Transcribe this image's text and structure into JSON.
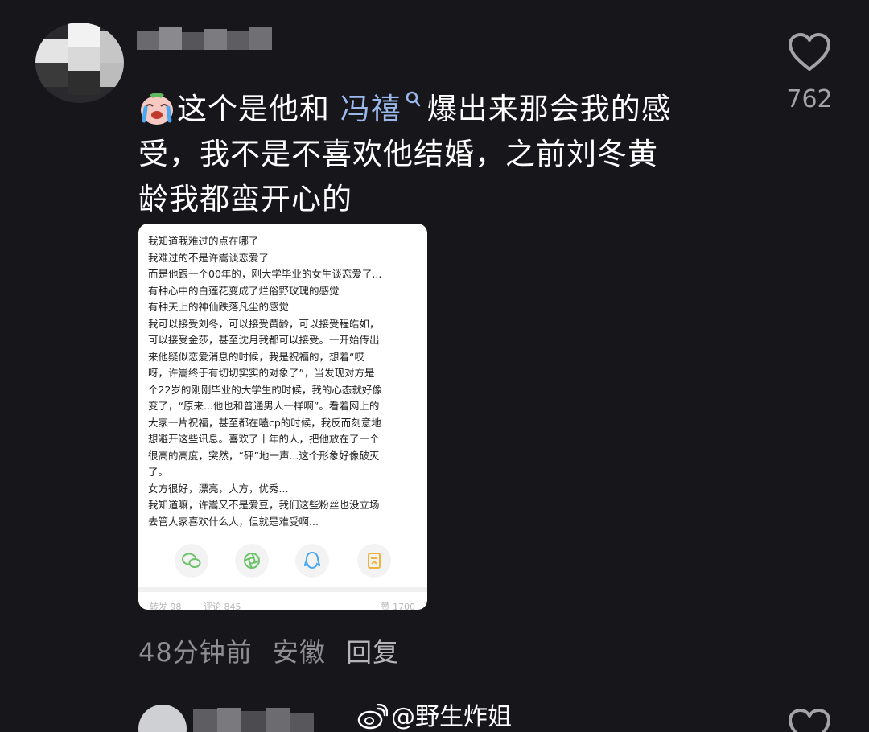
{
  "comment": {
    "text_before_mention": "这个是他和 ",
    "mention": "冯禧",
    "text_line1_rest": "爆出来那会我的感",
    "text_line2": "受，我不是不喜欢他结婚，之前刘冬黄",
    "text_line3": "龄我都蛮开心的",
    "emoji_icon": "crying-face-icon",
    "mention_icon": "search-icon"
  },
  "like": {
    "count": "762",
    "icon": "heart-outline-icon"
  },
  "card": {
    "lines": [
      "我知道我难过的点在哪了",
      "我难过的不是许嵩谈恋爱了",
      "而是他跟一个00年的，刚大学毕业的女生谈恋爱了...",
      "有种心中的白莲花变成了烂俗野玫瑰的感觉",
      "有种天上的神仙跌落凡尘的感觉",
      "我可以接受刘冬，可以接受黄龄，可以接受程皓如，",
      "可以接受金莎，甚至沈月我都可以接受。一开始传出",
      "来他疑似恋爱消息的时候，我是祝福的，想着“哎",
      "呀，许嵩终于有切切实实的对象了”，当发现对方是",
      "个22岁的刚刚毕业的大学生的时候，我的心态就好像",
      "变了，“原来...他也和普通男人一样啊”。看着网上的",
      "大家一片祝福，甚至都在嗑cp的时候，我反而刻意地",
      "想避开这些讯息。喜欢了十年的人，把他放在了一个",
      "很高的高度，突然，“砰”地一声...这个形象好像破灭",
      "了。",
      "女方很好，漂亮，大方，优秀...",
      "我知道嘛，许嵩又不是爱豆，我们这些粉丝也没立场",
      "去管人家喜欢什么人，但就是难受啊..."
    ],
    "share_icons": [
      "wechat-icon",
      "moments-icon",
      "qq-icon",
      "qzone-icon"
    ],
    "footer": {
      "repost": "转发 98",
      "comments": "评论 845",
      "likes": "赞 1700"
    }
  },
  "meta": {
    "time": "48分钟前",
    "location": "安徽",
    "reply": "回复"
  },
  "watermark": {
    "text": "@野生炸姐",
    "icon": "weibo-icon"
  },
  "colors": {
    "background": "#17161b",
    "mention": "#9ab8ea",
    "meta": "#8e8e93"
  }
}
